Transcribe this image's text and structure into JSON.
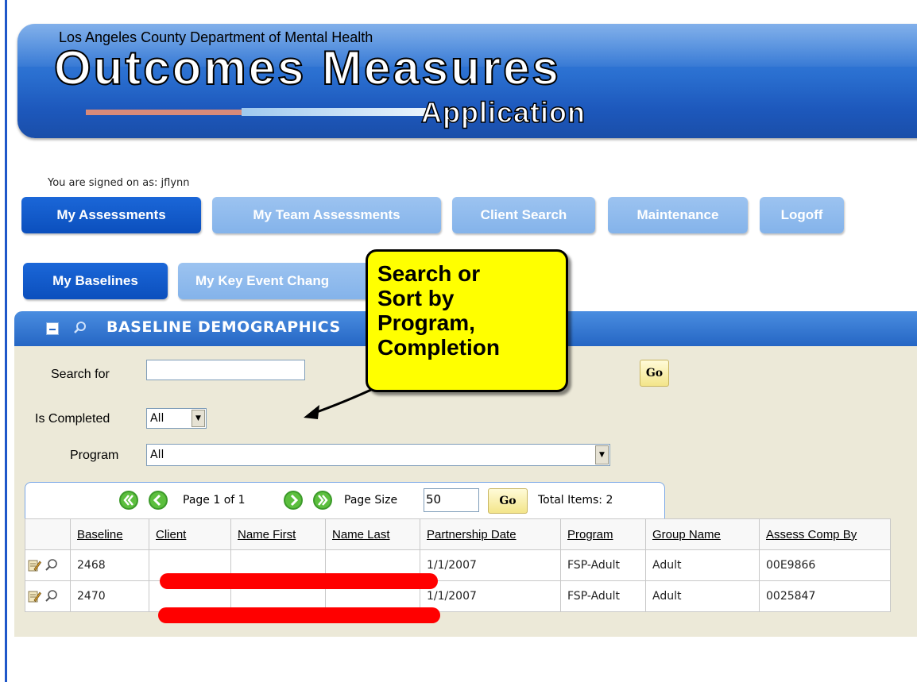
{
  "banner": {
    "department": "Los Angeles County Department of Mental Health",
    "title": "Outcomes Measures",
    "subtitle": "Application"
  },
  "signed_on": "You are signed on as: jflynn",
  "nav": [
    {
      "label": "My Assessments",
      "active": true
    },
    {
      "label": "My Team Assessments",
      "active": false
    },
    {
      "label": "Client Search",
      "active": false
    },
    {
      "label": "Maintenance",
      "active": false
    },
    {
      "label": "Logoff",
      "active": false
    }
  ],
  "subnav": [
    {
      "label": "My Baselines",
      "active": true
    },
    {
      "label": "My Key Event Chang",
      "active": false
    }
  ],
  "callout": {
    "lines": [
      "Search or",
      "Sort by",
      "Program,",
      "Completion"
    ]
  },
  "panel": {
    "title": "BASELINE DEMOGRAPHICS"
  },
  "search": {
    "label": "Search for",
    "value": "",
    "go": "Go",
    "completed_label": "Is Completed",
    "completed_value": "All",
    "program_label": "Program",
    "program_value": "All"
  },
  "pager": {
    "page_text": "Page 1 of 1",
    "page_size_label": "Page Size",
    "page_size_value": "50",
    "go": "Go",
    "total": "Total Items: 2"
  },
  "table": {
    "columns": [
      "Baseline",
      "Client",
      "Name First",
      "Name Last",
      "Partnership Date",
      "Program",
      "Group Name",
      "Assess Comp By"
    ],
    "rows": [
      {
        "baseline": "2468",
        "client": "",
        "first": "",
        "last": "",
        "date": "1/1/2007",
        "program": "FSP-Adult",
        "group": "Adult",
        "comp_by": "00E9866"
      },
      {
        "baseline": "2470",
        "client": "",
        "first": "",
        "last": "",
        "date": "1/1/2007",
        "program": "FSP-Adult",
        "group": "Adult",
        "comp_by": "0025847"
      }
    ]
  },
  "colors": {
    "banner_blue": "#2a6fd0",
    "nav_active": "#0b4fbd",
    "nav_inactive": "#84b3ea",
    "callout": "#ffff00",
    "redaction": "#ff0000",
    "panel_bg": "#ece9d8"
  }
}
